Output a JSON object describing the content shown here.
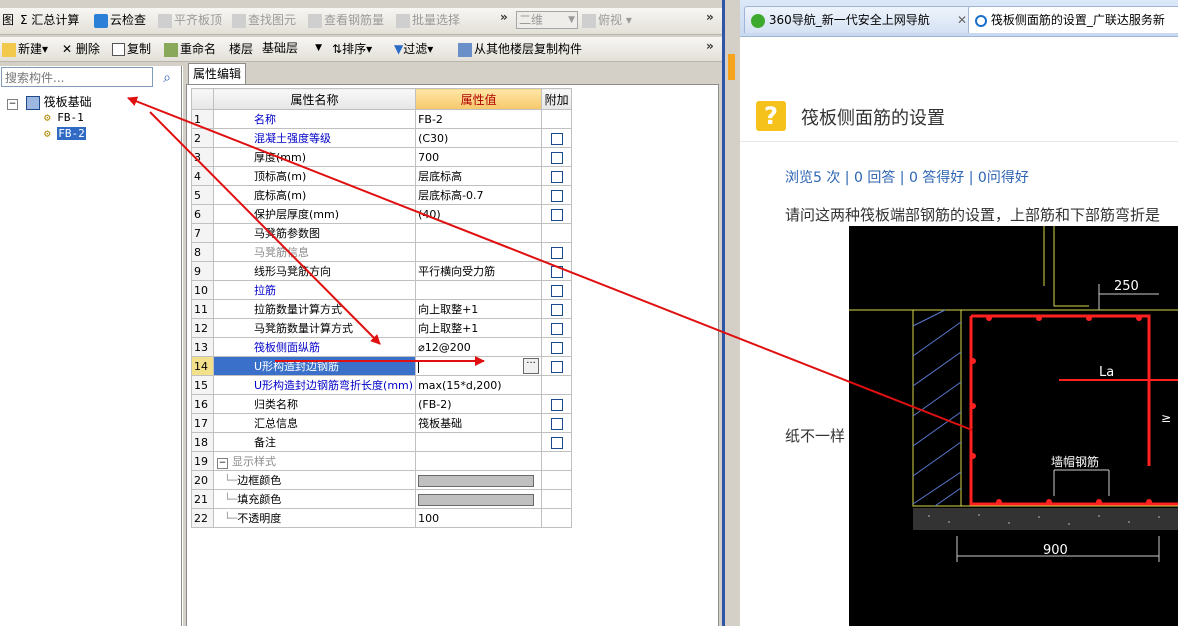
{
  "toolbar1": {
    "items": [
      "图",
      "Σ 汇总计算",
      "云检查",
      "平齐板顶",
      "查找图元",
      "查看钢筋量",
      "批量选择"
    ],
    "view_combo": "二维",
    "view_mode": "俯视"
  },
  "toolbar2": {
    "new": "新建",
    "delete": "删除",
    "copy": "复制",
    "rename": "重命名",
    "floor_label": "楼层",
    "floor_value": "基础层",
    "sort": "排序",
    "filter": "过滤",
    "copy_from_floor": "从其他楼层复制构件"
  },
  "tree": {
    "search_placeholder": "搜索构件...",
    "root": "筏板基础",
    "children": [
      "FB-1",
      "FB-2"
    ]
  },
  "property_tab": "属性编辑",
  "grid": {
    "headers": [
      "属性名称",
      "属性值",
      "附加"
    ],
    "rows": [
      {
        "n": "1",
        "name": "名称",
        "value": "FB-2",
        "style": "blue",
        "cb": false
      },
      {
        "n": "2",
        "name": "混凝土强度等级",
        "value": "(C30)",
        "style": "blue",
        "cb": true
      },
      {
        "n": "3",
        "name": "厚度(mm)",
        "value": "700",
        "style": "",
        "cb": true
      },
      {
        "n": "4",
        "name": "顶标高(m)",
        "value": "层底标高",
        "style": "",
        "cb": true
      },
      {
        "n": "5",
        "name": "底标高(m)",
        "value": "层底标高-0.7",
        "style": "",
        "cb": true
      },
      {
        "n": "6",
        "name": "保护层厚度(mm)",
        "value": "(40)",
        "style": "",
        "cb": true
      },
      {
        "n": "7",
        "name": "马凳筋参数图",
        "value": "",
        "style": "",
        "cb": false
      },
      {
        "n": "8",
        "name": "马凳筋信息",
        "value": "",
        "style": "gray",
        "cb": true
      },
      {
        "n": "9",
        "name": "线形马凳筋方向",
        "value": "平行横向受力筋",
        "style": "",
        "cb": true
      },
      {
        "n": "10",
        "name": "拉筋",
        "value": "",
        "style": "blue",
        "cb": true
      },
      {
        "n": "11",
        "name": "拉筋数量计算方式",
        "value": "向上取整+1",
        "style": "",
        "cb": true
      },
      {
        "n": "12",
        "name": "马凳筋数量计算方式",
        "value": "向上取整+1",
        "style": "",
        "cb": true
      },
      {
        "n": "13",
        "name": "筏板侧面纵筋",
        "value": "⌀12@200",
        "style": "blue",
        "cb": true
      },
      {
        "n": "14",
        "name": "U形构造封边钢筋",
        "value": "",
        "style": "cur",
        "cb": true
      },
      {
        "n": "15",
        "name": "U形构造封边钢筋弯折长度(mm)",
        "value": "max(15*d,200)",
        "style": "blue",
        "cb": false
      },
      {
        "n": "16",
        "name": "归类名称",
        "value": "(FB-2)",
        "style": "",
        "cb": true
      },
      {
        "n": "17",
        "name": "汇总信息",
        "value": "筏板基础",
        "style": "",
        "cb": true
      },
      {
        "n": "18",
        "name": "备注",
        "value": "",
        "style": "",
        "cb": true
      },
      {
        "n": "19",
        "name": "显示样式",
        "value": "",
        "style": "group",
        "cb": false
      },
      {
        "n": "20",
        "name": "边框颜色",
        "value": "",
        "style": "swatch",
        "cb": false
      },
      {
        "n": "21",
        "name": "填充颜色",
        "value": "",
        "style": "swatch",
        "cb": false
      },
      {
        "n": "22",
        "name": "不透明度",
        "value": "100",
        "style": "sub",
        "cb": false
      }
    ]
  },
  "browser": {
    "tab1": "360导航_新一代安全上网导航",
    "tab2": "筏板侧面筋的设置_广联达服务新",
    "question_title": "筏板侧面筋的设置",
    "stats": "浏览5 次 | 0 回答 | 0 答得好 | 0问得好",
    "body_line1": "请问这两种筏板端部钢筋的设置，上部筋和下部筋弯折是",
    "body_line2": "纸不一样",
    "cad_labels": {
      "dim_top": "250",
      "la": "La",
      "side": "≥",
      "cap": "墙帽钢筋",
      "dim_bottom": "900"
    }
  },
  "colors": {
    "annotation_arrow": "#e01010",
    "selection": "#316ac5",
    "header_value": "#f7c86b"
  }
}
